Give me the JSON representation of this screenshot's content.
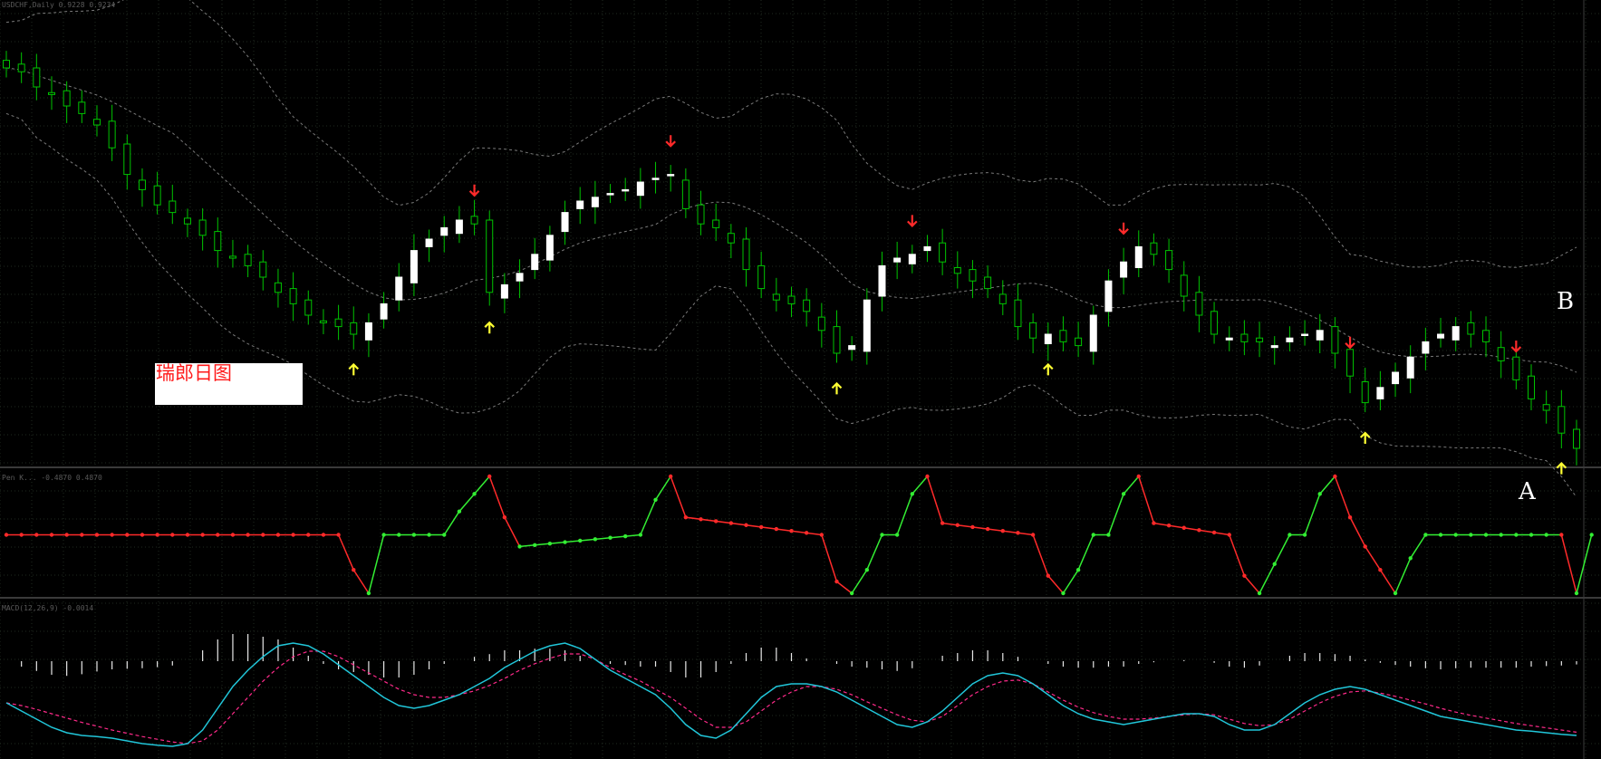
{
  "colors": {
    "background": "#000000",
    "grid": "#1f2a1f",
    "candle_bull": "#ffffff",
    "candle_bear": "#00c400",
    "band": "#7a7a7a",
    "sell_arrow": "#ff2a2a",
    "buy_arrow": "#ffff33",
    "osc_up": "#33ee33",
    "osc_down": "#ff2a2a",
    "macd_line": "#21c6d9",
    "signal_line": "#ff2a8a",
    "histogram": "#e8e8e8",
    "title_text": "#ff1a1a",
    "title_bg": "#ffffff"
  },
  "labels": {
    "title": "瑞郎日图",
    "marker_b": "B",
    "marker_a": "A",
    "header_main": "USDCHF,Daily 0.9228 0.9234",
    "header_osc": "Pen K... -0.4870 0.4870",
    "header_macd": "MACD(12,26,9) -0.0014"
  },
  "chart_data": [
    {
      "type": "candlestick",
      "panel": "price",
      "bars": 105,
      "close": [
        1.0,
        0.99,
        0.95,
        0.93,
        0.9,
        0.88,
        0.85,
        0.79,
        0.72,
        0.68,
        0.64,
        0.62,
        0.59,
        0.56,
        0.52,
        0.5,
        0.48,
        0.45,
        0.41,
        0.38,
        0.35,
        0.33,
        0.32,
        0.3,
        0.33,
        0.38,
        0.45,
        0.52,
        0.55,
        0.58,
        0.6,
        0.59,
        0.41,
        0.43,
        0.46,
        0.51,
        0.56,
        0.62,
        0.65,
        0.66,
        0.67,
        0.68,
        0.7,
        0.71,
        0.72,
        0.63,
        0.59,
        0.58,
        0.54,
        0.47,
        0.42,
        0.39,
        0.38,
        0.36,
        0.31,
        0.25,
        0.27,
        0.39,
        0.48,
        0.5,
        0.51,
        0.53,
        0.49,
        0.46,
        0.44,
        0.42,
        0.38,
        0.32,
        0.29,
        0.3,
        0.28,
        0.27,
        0.35,
        0.44,
        0.49,
        0.53,
        0.51,
        0.47,
        0.4,
        0.35,
        0.3,
        0.29,
        0.28,
        0.28,
        0.27,
        0.29,
        0.3,
        0.31,
        0.25,
        0.19,
        0.12,
        0.16,
        0.2,
        0.24,
        0.28,
        0.3,
        0.32,
        0.3,
        0.28,
        0.23,
        0.18,
        0.13,
        0.1,
        0.04,
        0.0
      ],
      "series": [
        {
          "name": "",
          "role": "upper bollinger band"
        },
        {
          "name": "",
          "role": "middle bollinger band"
        },
        {
          "name": "",
          "role": "lower bollinger band"
        }
      ],
      "sell_arrows_at_bar": [
        31,
        44,
        60,
        74,
        89,
        100
      ],
      "buy_arrows_at_bar": [
        23,
        32,
        55,
        69,
        90,
        103
      ],
      "annotations": [
        "瑞郎日图",
        "B"
      ],
      "title": "",
      "xlabel": "",
      "ylabel": "",
      "grid": true
    },
    {
      "type": "line",
      "panel": "oscillator",
      "ylim": [
        -1,
        1
      ],
      "x": [
        0,
        22,
        23,
        24,
        25,
        29,
        30,
        31,
        32,
        33,
        34,
        42,
        43,
        44,
        45,
        54,
        55,
        56,
        57,
        58,
        59,
        60,
        61,
        62,
        68,
        69,
        70,
        71,
        72,
        73,
        74,
        75,
        76,
        81,
        82,
        83,
        84,
        85,
        86,
        87,
        88,
        89,
        90,
        91,
        92,
        93,
        94,
        103,
        104,
        105
      ],
      "values": [
        0,
        0,
        -0.6,
        -1,
        0,
        0,
        0.4,
        0.7,
        1,
        0.3,
        -0.2,
        0,
        0.6,
        1,
        0.3,
        0,
        -0.8,
        -1,
        -0.6,
        0,
        0,
        0.7,
        1,
        0.2,
        0,
        -0.7,
        -1,
        -0.6,
        0,
        0,
        0.7,
        1,
        0.2,
        0,
        -0.7,
        -1,
        -0.5,
        0,
        0,
        0.7,
        1,
        0.3,
        -0.2,
        -0.6,
        -1,
        -0.4,
        0,
        0,
        -1,
        0
      ],
      "series": [
        {
          "name": "",
          "role": "rising segments"
        },
        {
          "name": "",
          "role": "falling segments"
        }
      ],
      "annotations": [
        "A"
      ],
      "title": "",
      "xlabel": "",
      "ylabel": ""
    },
    {
      "type": "line",
      "panel": "macd",
      "ylim": [
        -1,
        1
      ],
      "series": [
        {
          "name": "",
          "role": "main line"
        },
        {
          "name": "",
          "role": "signal line"
        },
        {
          "name": "",
          "role": "histogram"
        }
      ],
      "main": [
        -0.1,
        -0.25,
        -0.4,
        -0.55,
        -0.65,
        -0.7,
        -0.72,
        -0.75,
        -0.8,
        -0.85,
        -0.88,
        -0.9,
        -0.85,
        -0.6,
        -0.2,
        0.2,
        0.5,
        0.75,
        0.95,
        1.0,
        0.95,
        0.8,
        0.6,
        0.4,
        0.2,
        0.0,
        -0.15,
        -0.2,
        -0.15,
        -0.05,
        0.05,
        0.2,
        0.35,
        0.55,
        0.7,
        0.85,
        0.95,
        1.0,
        0.9,
        0.7,
        0.5,
        0.35,
        0.2,
        0.05,
        -0.2,
        -0.5,
        -0.7,
        -0.75,
        -0.6,
        -0.3,
        0.0,
        0.2,
        0.25,
        0.25,
        0.2,
        0.1,
        -0.05,
        -0.2,
        -0.35,
        -0.5,
        -0.55,
        -0.45,
        -0.25,
        0.0,
        0.25,
        0.4,
        0.45,
        0.4,
        0.25,
        0.05,
        -0.15,
        -0.3,
        -0.4,
        -0.45,
        -0.5,
        -0.45,
        -0.4,
        -0.35,
        -0.3,
        -0.3,
        -0.35,
        -0.5,
        -0.6,
        -0.6,
        -0.5,
        -0.3,
        -0.1,
        0.05,
        0.15,
        0.2,
        0.15,
        0.05,
        -0.05,
        -0.15,
        -0.25,
        -0.35,
        -0.4,
        -0.45,
        -0.5,
        -0.55,
        -0.6,
        -0.62,
        -0.65,
        -0.68,
        -0.7
      ],
      "signal": [
        -0.1,
        -0.15,
        -0.22,
        -0.3,
        -0.38,
        -0.46,
        -0.53,
        -0.6,
        -0.66,
        -0.72,
        -0.77,
        -0.82,
        -0.85,
        -0.8,
        -0.6,
        -0.3,
        0.0,
        0.3,
        0.55,
        0.75,
        0.85,
        0.85,
        0.75,
        0.6,
        0.45,
        0.3,
        0.15,
        0.05,
        0.0,
        0.0,
        0.05,
        0.12,
        0.22,
        0.35,
        0.5,
        0.62,
        0.72,
        0.8,
        0.8,
        0.7,
        0.55,
        0.42,
        0.3,
        0.15,
        0.0,
        -0.2,
        -0.4,
        -0.55,
        -0.55,
        -0.45,
        -0.25,
        -0.05,
        0.1,
        0.2,
        0.2,
        0.15,
        0.05,
        -0.08,
        -0.2,
        -0.32,
        -0.42,
        -0.45,
        -0.35,
        -0.15,
        0.05,
        0.2,
        0.3,
        0.32,
        0.25,
        0.1,
        -0.05,
        -0.18,
        -0.28,
        -0.35,
        -0.4,
        -0.4,
        -0.38,
        -0.35,
        -0.32,
        -0.3,
        -0.32,
        -0.4,
        -0.48,
        -0.52,
        -0.5,
        -0.4,
        -0.25,
        -0.1,
        0.02,
        0.1,
        0.12,
        0.08,
        0.02,
        -0.05,
        -0.12,
        -0.2,
        -0.27,
        -0.33,
        -0.38,
        -0.43,
        -0.48,
        -0.52,
        -0.56,
        -0.6,
        -0.64
      ],
      "annotations": [],
      "title": "",
      "xlabel": "",
      "ylabel": ""
    }
  ]
}
